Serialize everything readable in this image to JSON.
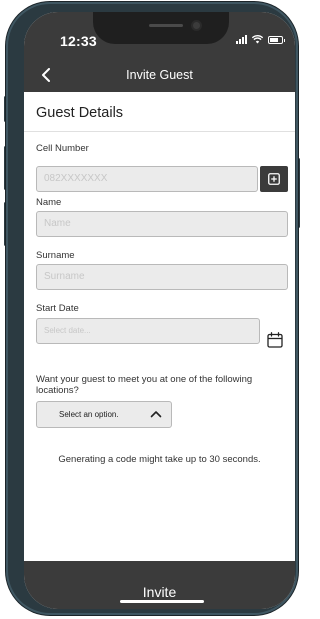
{
  "status_bar": {
    "time": "12:33"
  },
  "nav": {
    "title": "Invite Guest",
    "back_icon": "chevron-left-icon"
  },
  "section": {
    "title": "Guest Details"
  },
  "form": {
    "cell_number": {
      "label": "Cell Number",
      "placeholder": "082XXXXXXX",
      "value": ""
    },
    "name": {
      "label": "Name",
      "placeholder": "Name",
      "value": ""
    },
    "surname": {
      "label": "Surname",
      "placeholder": "Surname",
      "value": ""
    },
    "start_date": {
      "label": "Start Date",
      "placeholder": "Select date...",
      "value": ""
    },
    "location_question": "Want your guest to meet you at one of the following locations?",
    "location_select": {
      "value": "Select an option."
    }
  },
  "notice": "Generating a code might take up to 30 seconds.",
  "footer": {
    "invite_label": "Invite"
  },
  "colors": {
    "dark_bar": "#3b3b3b",
    "input_bg": "#ebebeb",
    "frame": "#2b3a41"
  }
}
